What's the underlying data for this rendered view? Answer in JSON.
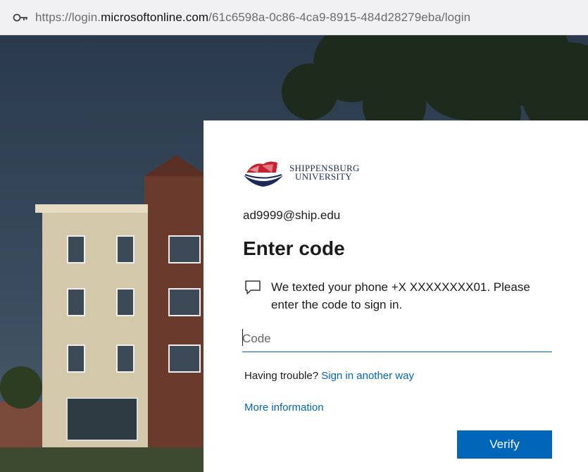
{
  "browser": {
    "url_prefix": "https://login.",
    "url_host": "microsoftonline.com",
    "url_path": "/61c6598a-0c86-4ca9-8915-484d28279eba/login",
    "address_icon": "key-icon"
  },
  "logo": {
    "line1": "SHIPPENSBURG",
    "line2": "UNIVERSITY",
    "colors": {
      "red": "#c8202f",
      "navy": "#1b2a57"
    }
  },
  "signin": {
    "account": "ad9999@ship.edu",
    "title": "Enter code",
    "message": "We texted your phone +X XXXXXXXX01. Please enter the code to sign in.",
    "message_icon": "chat-bubble-icon",
    "code_placeholder": "Code",
    "code_value": "",
    "trouble_text": "Having trouble?",
    "trouble_link": "Sign in another way",
    "more_info_link": "More information",
    "verify_label": "Verify"
  },
  "theme": {
    "accent": "#0067b8",
    "text": "#1b1b1b"
  }
}
